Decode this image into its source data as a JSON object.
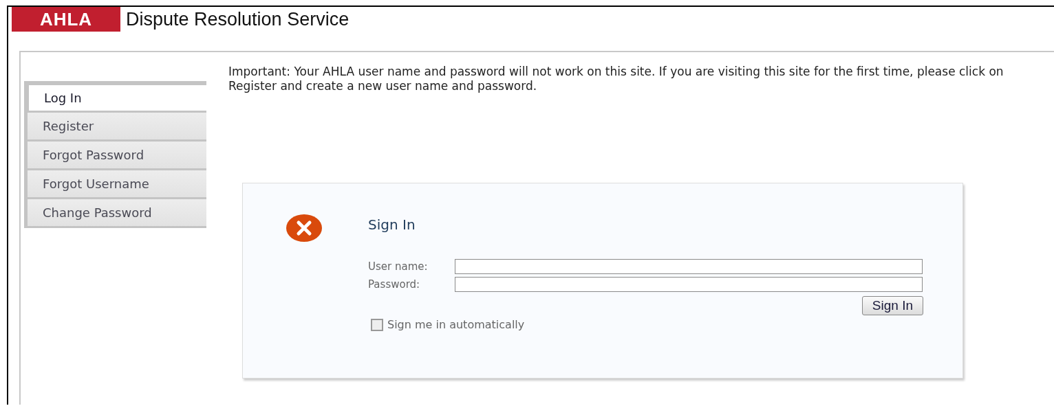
{
  "header": {
    "logo": "AHLA",
    "title": "Dispute Resolution Service"
  },
  "sidebar": {
    "items": [
      {
        "label": "Log In",
        "selected": true
      },
      {
        "label": "Register",
        "selected": false
      },
      {
        "label": "Forgot Password",
        "selected": false
      },
      {
        "label": "Forgot Username",
        "selected": false
      },
      {
        "label": "Change Password",
        "selected": false
      }
    ]
  },
  "notice": "Important: Your AHLA user name and password will not work on this site. If you are visiting this site for the first time, please click on Register and create a new user name and password.",
  "signin": {
    "title": "Sign In",
    "fields": [
      {
        "label": "User name:"
      },
      {
        "label": "Password:"
      }
    ],
    "button": "Sign In",
    "remember": {
      "label": "Sign me in automatically",
      "checked": false
    }
  }
}
